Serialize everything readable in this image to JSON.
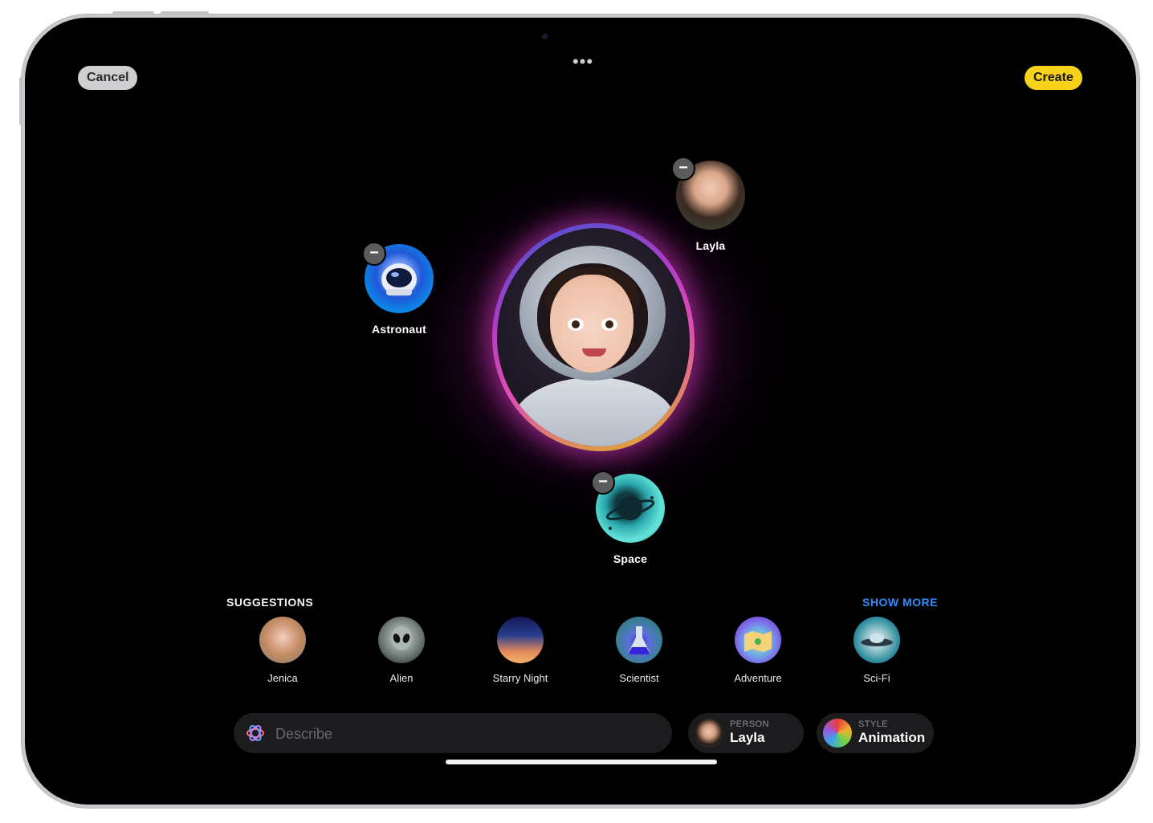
{
  "toolbar": {
    "cancel_label": "Cancel",
    "create_label": "Create",
    "more_icon": "ellipsis-icon"
  },
  "canvas": {
    "tokens": [
      {
        "label": "Astronaut",
        "icon": "astronaut-helmet-icon"
      },
      {
        "label": "Layla",
        "icon": "person-photo"
      },
      {
        "label": "Space",
        "icon": "planet-icon"
      }
    ]
  },
  "suggestions": {
    "title": "SUGGESTIONS",
    "show_more": "SHOW MORE",
    "items": [
      {
        "label": "Jenica"
      },
      {
        "label": "Alien"
      },
      {
        "label": "Starry Night"
      },
      {
        "label": "Scientist"
      },
      {
        "label": "Adventure"
      },
      {
        "label": "Sci-Fi"
      }
    ]
  },
  "bottom_bar": {
    "describe_placeholder": "Describe",
    "person": {
      "key": "PERSON",
      "value": "Layla"
    },
    "style": {
      "key": "STYLE",
      "value": "Animation"
    }
  },
  "colors": {
    "create_accent": "#f6d21a",
    "show_more_link": "#2f8cff",
    "glow": "#e04fb0"
  }
}
